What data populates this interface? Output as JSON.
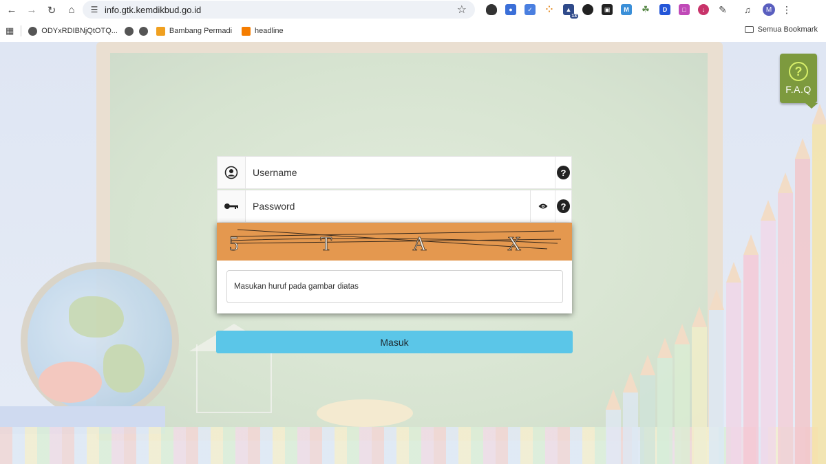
{
  "browser": {
    "url": "info.gtk.kemdikbud.go.id",
    "extension_badge": "13",
    "profile_initial": "M"
  },
  "bookmarks": {
    "items": [
      {
        "label": "ODYxRDIBNjQtOTQ..."
      },
      {
        "label": ""
      },
      {
        "label": ""
      },
      {
        "label": "Bambang Permadi"
      },
      {
        "label": "headline"
      }
    ],
    "all_bookmarks": "Semua Bookmark"
  },
  "faq": {
    "label": "F.A.Q",
    "icon_glyph": "?"
  },
  "login": {
    "username_placeholder": "Username",
    "password_placeholder": "Password",
    "help_glyph": "?",
    "captcha_text": "5 T A X",
    "captcha_placeholder": "Masukan huruf pada gambar diatas",
    "submit_label": "Masuk"
  },
  "colors": {
    "captcha_bg": "#e4984f",
    "submit_bg": "#5bc6e8",
    "faq_bg": "#7d9a3e"
  }
}
